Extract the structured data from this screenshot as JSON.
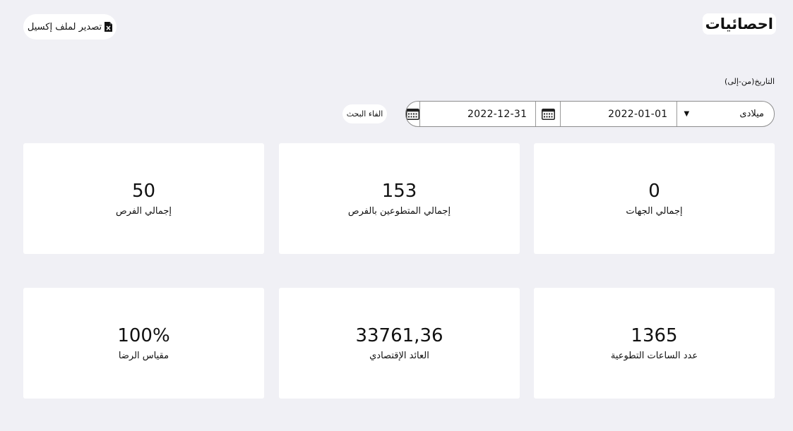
{
  "header": {
    "title": "احصائيات",
    "export_label": "تصدير لملف إكسيل"
  },
  "filter": {
    "date_label": "التاريخ(من-إلى)",
    "calendar_type": "ميلادى",
    "date_from": "2022-01-01",
    "date_to": "2022-12-31",
    "cancel_label": "الفاء البحث"
  },
  "stats": [
    {
      "value": "0",
      "label": "إجمالي الجهات"
    },
    {
      "value": "153",
      "label": "إجمالي المتطوعين بالفرص"
    },
    {
      "value": "50",
      "label": "إجمالي الفرص"
    },
    {
      "value": "1365",
      "label": "عدد الساعات التطوعية"
    },
    {
      "value": "33761,36",
      "label": "العائد الإقتصادي"
    },
    {
      "value": "100%",
      "label": "مقياس الرضا"
    }
  ],
  "icons": {
    "export": "excel-file-icon",
    "calendar": "calendar-icon",
    "dropdown": "chevron-down-icon"
  }
}
